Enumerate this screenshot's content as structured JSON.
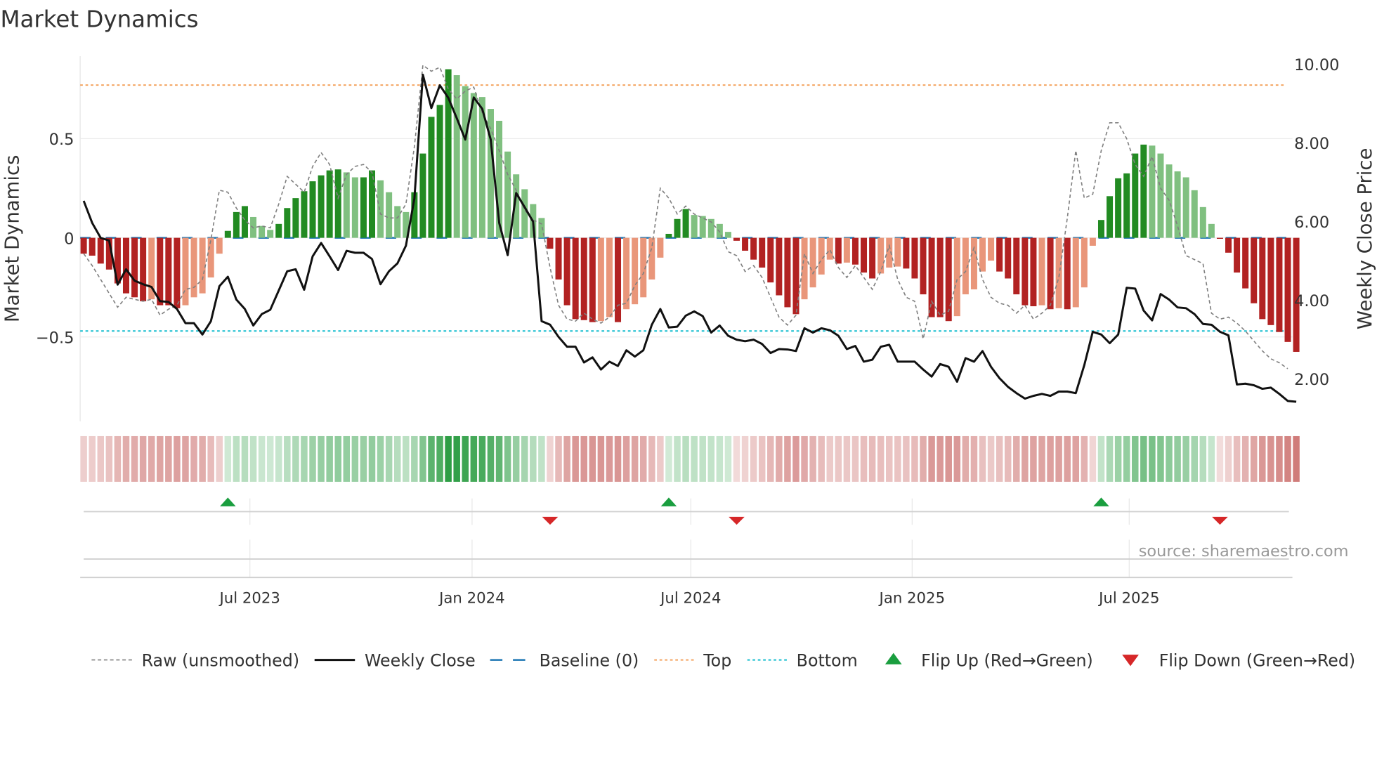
{
  "chart_data": {
    "type": "bar",
    "title": "Market Dynamics",
    "ylabel": "Market Dynamics",
    "ylabel_right": "Weekly Close Price",
    "ylim": [
      -0.92,
      0.92
    ],
    "ylim_right": [
      0.9,
      10.4
    ],
    "yticks": [
      {
        "v": 0.5,
        "label": "0.5"
      },
      {
        "v": 0,
        "label": "0"
      },
      {
        "v": -0.5,
        "label": "−0.5"
      }
    ],
    "yticks_right": [
      {
        "v": 10,
        "label": "10.00"
      },
      {
        "v": 8,
        "label": "8.00"
      },
      {
        "v": 6,
        "label": "6.00"
      },
      {
        "v": 4,
        "label": "4.00"
      },
      {
        "v": 2,
        "label": "2.00"
      }
    ],
    "xticks": [
      {
        "week": 19.6,
        "label": "Jul 2023"
      },
      {
        "week": 45.8,
        "label": "Jan 2024"
      },
      {
        "week": 71.6,
        "label": "Jul 2024"
      },
      {
        "week": 97.7,
        "label": "Jan 2025"
      },
      {
        "week": 123.3,
        "label": "Jul 2025"
      }
    ],
    "top": 0.77,
    "bottom": -0.47,
    "baseline": 0,
    "momentum": [
      -0.08,
      -0.09,
      -0.13,
      -0.16,
      -0.23,
      -0.28,
      -0.3,
      -0.32,
      -0.31,
      -0.34,
      -0.34,
      -0.355,
      -0.34,
      -0.3,
      -0.28,
      -0.2,
      -0.08,
      0.035,
      0.13,
      0.16,
      0.105,
      0.06,
      0.04,
      0.07,
      0.15,
      0.2,
      0.235,
      0.285,
      0.315,
      0.34,
      0.345,
      0.33,
      0.305,
      0.305,
      0.34,
      0.29,
      0.23,
      0.16,
      0.13,
      0.23,
      0.425,
      0.61,
      0.67,
      0.85,
      0.82,
      0.765,
      0.73,
      0.71,
      0.65,
      0.59,
      0.435,
      0.32,
      0.245,
      0.17,
      0.1,
      -0.055,
      -0.21,
      -0.34,
      -0.41,
      -0.415,
      -0.425,
      -0.42,
      -0.4,
      -0.425,
      -0.36,
      -0.335,
      -0.3,
      -0.21,
      -0.1,
      0.02,
      0.095,
      0.145,
      0.115,
      0.11,
      0.095,
      0.07,
      0.03,
      -0.015,
      -0.065,
      -0.11,
      -0.15,
      -0.225,
      -0.29,
      -0.35,
      -0.385,
      -0.31,
      -0.25,
      -0.185,
      -0.11,
      -0.13,
      -0.125,
      -0.135,
      -0.175,
      -0.205,
      -0.18,
      -0.15,
      -0.145,
      -0.155,
      -0.205,
      -0.285,
      -0.4,
      -0.4,
      -0.42,
      -0.395,
      -0.285,
      -0.26,
      -0.17,
      -0.115,
      -0.17,
      -0.205,
      -0.285,
      -0.34,
      -0.345,
      -0.34,
      -0.36,
      -0.355,
      -0.36,
      -0.35,
      -0.25,
      -0.04,
      0.09,
      0.21,
      0.3,
      0.325,
      0.425,
      0.47,
      0.465,
      0.425,
      0.37,
      0.335,
      0.305,
      0.24,
      0.155,
      0.07,
      -0.005,
      -0.075,
      -0.175,
      -0.255,
      -0.33,
      -0.41,
      -0.44,
      -0.475,
      -0.525,
      -0.575
    ],
    "raw": [
      -0.08,
      -0.14,
      -0.21,
      -0.28,
      -0.35,
      -0.3,
      -0.31,
      -0.32,
      -0.31,
      -0.39,
      -0.36,
      -0.34,
      -0.26,
      -0.25,
      -0.21,
      -0.01,
      0.24,
      0.23,
      0.15,
      0.09,
      0.05,
      0.06,
      0.05,
      0.17,
      0.31,
      0.27,
      0.23,
      0.36,
      0.43,
      0.37,
      0.2,
      0.32,
      0.36,
      0.37,
      0.33,
      0.12,
      0.1,
      0.1,
      0.17,
      0.46,
      0.87,
      0.84,
      0.86,
      0.75,
      0.7,
      0.74,
      0.76,
      0.63,
      0.55,
      0.44,
      0.32,
      0.24,
      0.14,
      0.09,
      0.07,
      -0.15,
      -0.34,
      -0.41,
      -0.42,
      -0.38,
      -0.41,
      -0.43,
      -0.4,
      -0.34,
      -0.33,
      -0.24,
      -0.18,
      -0.05,
      0.25,
      0.2,
      0.12,
      0.16,
      0.12,
      0.1,
      0.08,
      0.03,
      -0.07,
      -0.09,
      -0.17,
      -0.14,
      -0.2,
      -0.3,
      -0.4,
      -0.44,
      -0.39,
      -0.08,
      -0.18,
      -0.11,
      -0.06,
      -0.15,
      -0.2,
      -0.14,
      -0.2,
      -0.26,
      -0.17,
      -0.04,
      -0.21,
      -0.3,
      -0.32,
      -0.51,
      -0.32,
      -0.39,
      -0.37,
      -0.21,
      -0.17,
      -0.05,
      -0.21,
      -0.3,
      -0.33,
      -0.34,
      -0.38,
      -0.34,
      -0.41,
      -0.38,
      -0.34,
      -0.2,
      0.1,
      0.44,
      0.2,
      0.22,
      0.44,
      0.58,
      0.58,
      0.5,
      0.37,
      0.31,
      0.41,
      0.25,
      0.19,
      0.06,
      -0.09,
      -0.11,
      -0.13,
      -0.38,
      -0.41,
      -0.4,
      -0.43,
      -0.47,
      -0.52,
      -0.57,
      -0.61,
      -0.63,
      -0.66
    ],
    "close": [
      6.52,
      5.96,
      5.58,
      5.51,
      4.39,
      4.78,
      4.49,
      4.4,
      4.33,
      3.97,
      3.95,
      3.77,
      3.41,
      3.41,
      3.12,
      3.46,
      4.35,
      4.59,
      4.01,
      3.77,
      3.35,
      3.64,
      3.75,
      4.24,
      4.73,
      4.78,
      4.26,
      5.11,
      5.45,
      5.11,
      4.76,
      5.25,
      5.2,
      5.2,
      5.04,
      4.4,
      4.73,
      4.93,
      5.38,
      6.58,
      9.73,
      8.88,
      9.46,
      9.14,
      8.62,
      8.08,
      9.15,
      8.86,
      8.08,
      5.96,
      5.14,
      6.72,
      6.36,
      5.99,
      3.46,
      3.37,
      3.06,
      2.81,
      2.81,
      2.41,
      2.54,
      2.23,
      2.43,
      2.32,
      2.72,
      2.56,
      2.72,
      3.37,
      3.77,
      3.3,
      3.32,
      3.6,
      3.71,
      3.59,
      3.17,
      3.35,
      3.09,
      2.99,
      2.95,
      2.99,
      2.88,
      2.65,
      2.75,
      2.74,
      2.7,
      3.28,
      3.17,
      3.28,
      3.23,
      3.09,
      2.75,
      2.83,
      2.43,
      2.48,
      2.81,
      2.86,
      2.43,
      2.43,
      2.43,
      2.23,
      2.05,
      2.37,
      2.3,
      1.92,
      2.52,
      2.43,
      2.7,
      2.3,
      2.01,
      1.79,
      1.63,
      1.49,
      1.56,
      1.61,
      1.56,
      1.67,
      1.67,
      1.63,
      2.34,
      3.19,
      3.12,
      2.9,
      3.12,
      4.31,
      4.29,
      3.73,
      3.48,
      4.15,
      4.01,
      3.81,
      3.79,
      3.64,
      3.39,
      3.37,
      3.19,
      3.1,
      1.85,
      1.87,
      1.83,
      1.74,
      1.77,
      1.61,
      1.43,
      1.41
    ],
    "flip_up_weeks": [
      17,
      69,
      120
    ],
    "flip_down_weeks": [
      55,
      77,
      134
    ],
    "colors": {
      "green_strong": "#228b22",
      "green_weak": "#80c080",
      "red_strong": "#b22222",
      "red_weak": "#e9967a",
      "baseline": "#1f77b4",
      "top": "#f4a460",
      "bottom": "#17becf",
      "raw": "#808080",
      "close": "#111111",
      "flip_up": "#1a9e3f",
      "flip_down": "#d62728"
    },
    "legend": [
      {
        "key": "raw",
        "label": "Raw (unsmoothed)"
      },
      {
        "key": "close",
        "label": "Weekly Close"
      },
      {
        "key": "baseline",
        "label": "Baseline (0)"
      },
      {
        "key": "top",
        "label": "Top"
      },
      {
        "key": "bottom",
        "label": "Bottom"
      },
      {
        "key": "flip_up",
        "label": "Flip Up (Red→Green)"
      },
      {
        "key": "flip_down",
        "label": "Flip Down (Green→Red)"
      }
    ],
    "legend_position": "bottom"
  },
  "source": "source: sharemaestro.com"
}
